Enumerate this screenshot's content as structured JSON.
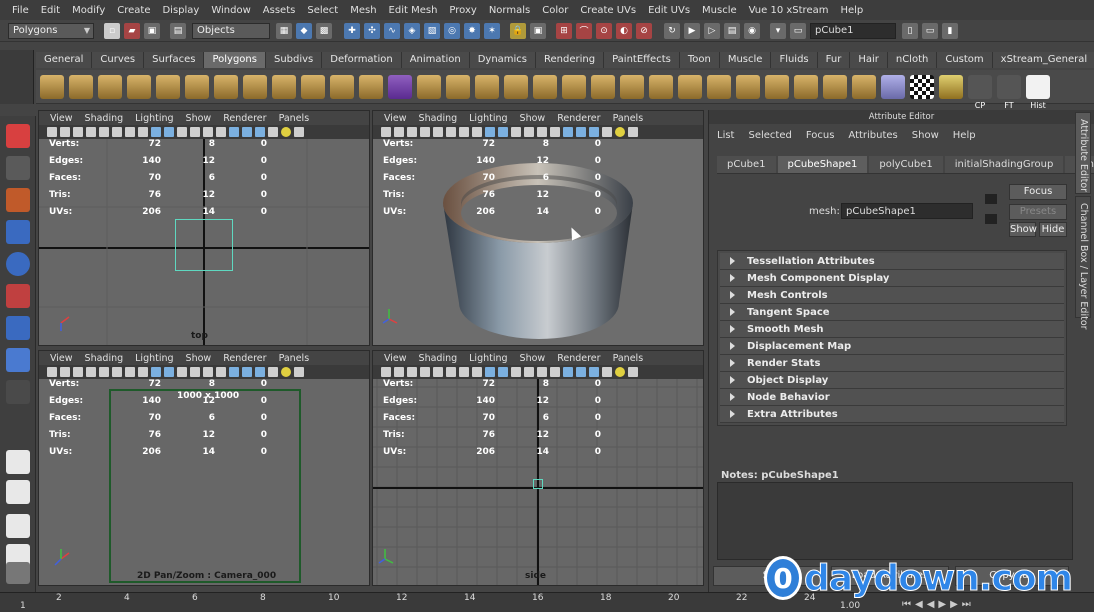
{
  "menubar": [
    "File",
    "Edit",
    "Modify",
    "Create",
    "Display",
    "Window",
    "Assets",
    "Select",
    "Mesh",
    "Edit Mesh",
    "Proxy",
    "Normals",
    "Color",
    "Create UVs",
    "Edit UVs",
    "Muscle",
    "Vue 10 xStream",
    "Help"
  ],
  "status": {
    "mode": "Polygons",
    "selection_mode": "Objects",
    "object_name": "pCube1"
  },
  "shelf_tabs": [
    "General",
    "Curves",
    "Surfaces",
    "Polygons",
    "Subdivs",
    "Deformation",
    "Animation",
    "Dynamics",
    "Rendering",
    "PaintEffects",
    "Toon",
    "Muscle",
    "Fluids",
    "Fur",
    "Hair",
    "nCloth",
    "Custom",
    "xStream_General",
    "xStre"
  ],
  "shelf_active": "Polygons",
  "shelf_icon_labels": {
    "cp": "CP",
    "ft": "FT",
    "hist": "Hist"
  },
  "panel_menu": [
    "View",
    "Shading",
    "Lighting",
    "Show",
    "Renderer",
    "Panels"
  ],
  "hud": {
    "labels": [
      "Verts:",
      "Edges:",
      "Faces:",
      "Tris:",
      "UVs:"
    ],
    "rows": [
      [
        "72",
        "8",
        "0"
      ],
      [
        "140",
        "12",
        "0"
      ],
      [
        "70",
        "6",
        "0"
      ],
      [
        "76",
        "12",
        "0"
      ],
      [
        "206",
        "14",
        "0"
      ]
    ]
  },
  "viewports": {
    "top": {
      "camera": "top"
    },
    "persp": {
      "camera": ""
    },
    "pan": {
      "resolution": "1000 x 1000",
      "camera": "2D Pan/Zoom : Camera_000"
    },
    "side": {
      "camera": "side"
    }
  },
  "attribute_editor": {
    "title": "Attribute Editor",
    "menu": [
      "List",
      "Selected",
      "Focus",
      "Attributes",
      "Show",
      "Help"
    ],
    "tabs": [
      "pCube1",
      "pCubeShape1",
      "polyCube1",
      "initialShadingGroup",
      "lambert1"
    ],
    "active_tab": "pCubeShape1",
    "mesh_label": "mesh:",
    "mesh_value": "pCubeShape1",
    "buttons": {
      "focus": "Focus",
      "presets": "Presets",
      "show": "Show",
      "hide": "Hide"
    },
    "sections": [
      "Tessellation Attributes",
      "Mesh Component Display",
      "Mesh Controls",
      "Tangent Space",
      "Smooth Mesh",
      "Displacement Map",
      "Render Stats",
      "Object Display",
      "Node Behavior",
      "Extra Attributes"
    ],
    "notes_label": "Notes:  pCubeShape1",
    "bottom_buttons": [
      "Se",
      "Load Attributes",
      "Copy Tab"
    ]
  },
  "side_tabs": [
    "Attribute Editor",
    "Channel Box / Layer Editor"
  ],
  "timeline": {
    "start": "1",
    "ticks": [
      "2",
      "4",
      "6",
      "8",
      "10",
      "12",
      "14",
      "16",
      "18",
      "20",
      "22",
      "24"
    ],
    "current": "1.00"
  },
  "watermark": {
    "mark": "0",
    "text": "daydown.com"
  },
  "colors": {
    "viewport_bg": "#676767",
    "accent_blue": "#2f86e8",
    "selection_green": "#3a7a3a"
  }
}
